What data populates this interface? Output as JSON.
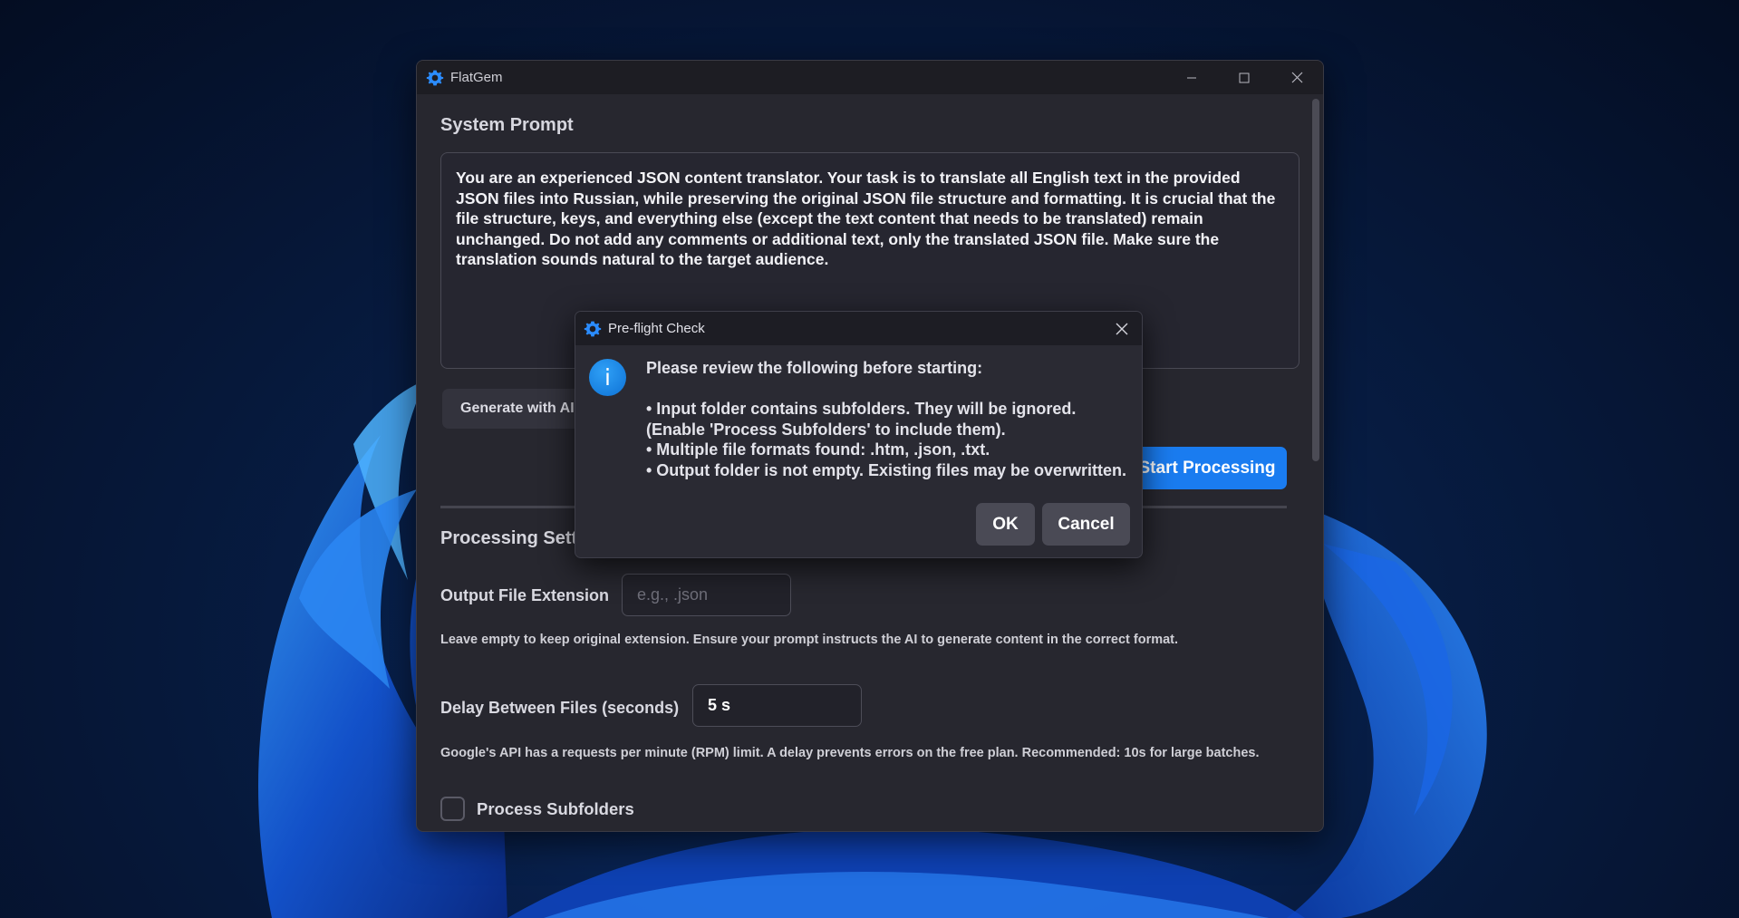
{
  "window": {
    "title": "FlatGem",
    "minimize_icon": "minimize-icon",
    "maximize_icon": "maximize-icon",
    "close_icon": "close-icon"
  },
  "system_prompt": {
    "heading": "System Prompt",
    "text": "You are an experienced JSON content translator. Your task is to translate all English text in the provided JSON files into Russian, while preserving the original JSON file structure and formatting. It is crucial that the file structure, keys, and everything else (except the text content that needs to be translated) remain unchanged. Do not add any comments or additional text, only the translated JSON file. Make sure the translation sounds natural to the target audience.",
    "generate_button": "Generate with AI",
    "start_button": "Start Processing"
  },
  "processing_settings": {
    "heading": "Processing Sett",
    "output_ext_label": "Output File Extension",
    "output_ext_placeholder": "e.g., .json",
    "output_ext_value": "",
    "output_ext_hint": "Leave empty to keep original extension. Ensure your prompt instructs the AI to generate content in the correct format.",
    "delay_label": "Delay Between Files (seconds)",
    "delay_value": "5 s",
    "delay_hint": "Google's API has a requests per minute (RPM) limit. A delay prevents errors on the free plan. Recommended: 10s for large batches.",
    "subfolders_label": "Process Subfolders",
    "subfolders_checked": false
  },
  "dialog": {
    "title": "Pre-flight Check",
    "icon": "info-icon",
    "icon_glyph": "i",
    "heading": "Please review the following before starting:",
    "items": [
      "• Input folder contains subfolders. They will be ignored. (Enable 'Process Subfolders' to include them).",
      "• Multiple file formats found: .htm, .json, .txt.",
      "• Output folder is not empty. Existing files may be overwritten."
    ],
    "ok_button": "OK",
    "cancel_button": "Cancel"
  },
  "colors": {
    "accent": "#1a7cf0",
    "window_bg": "#27272f",
    "titlebar_bg": "#1d1d23"
  }
}
